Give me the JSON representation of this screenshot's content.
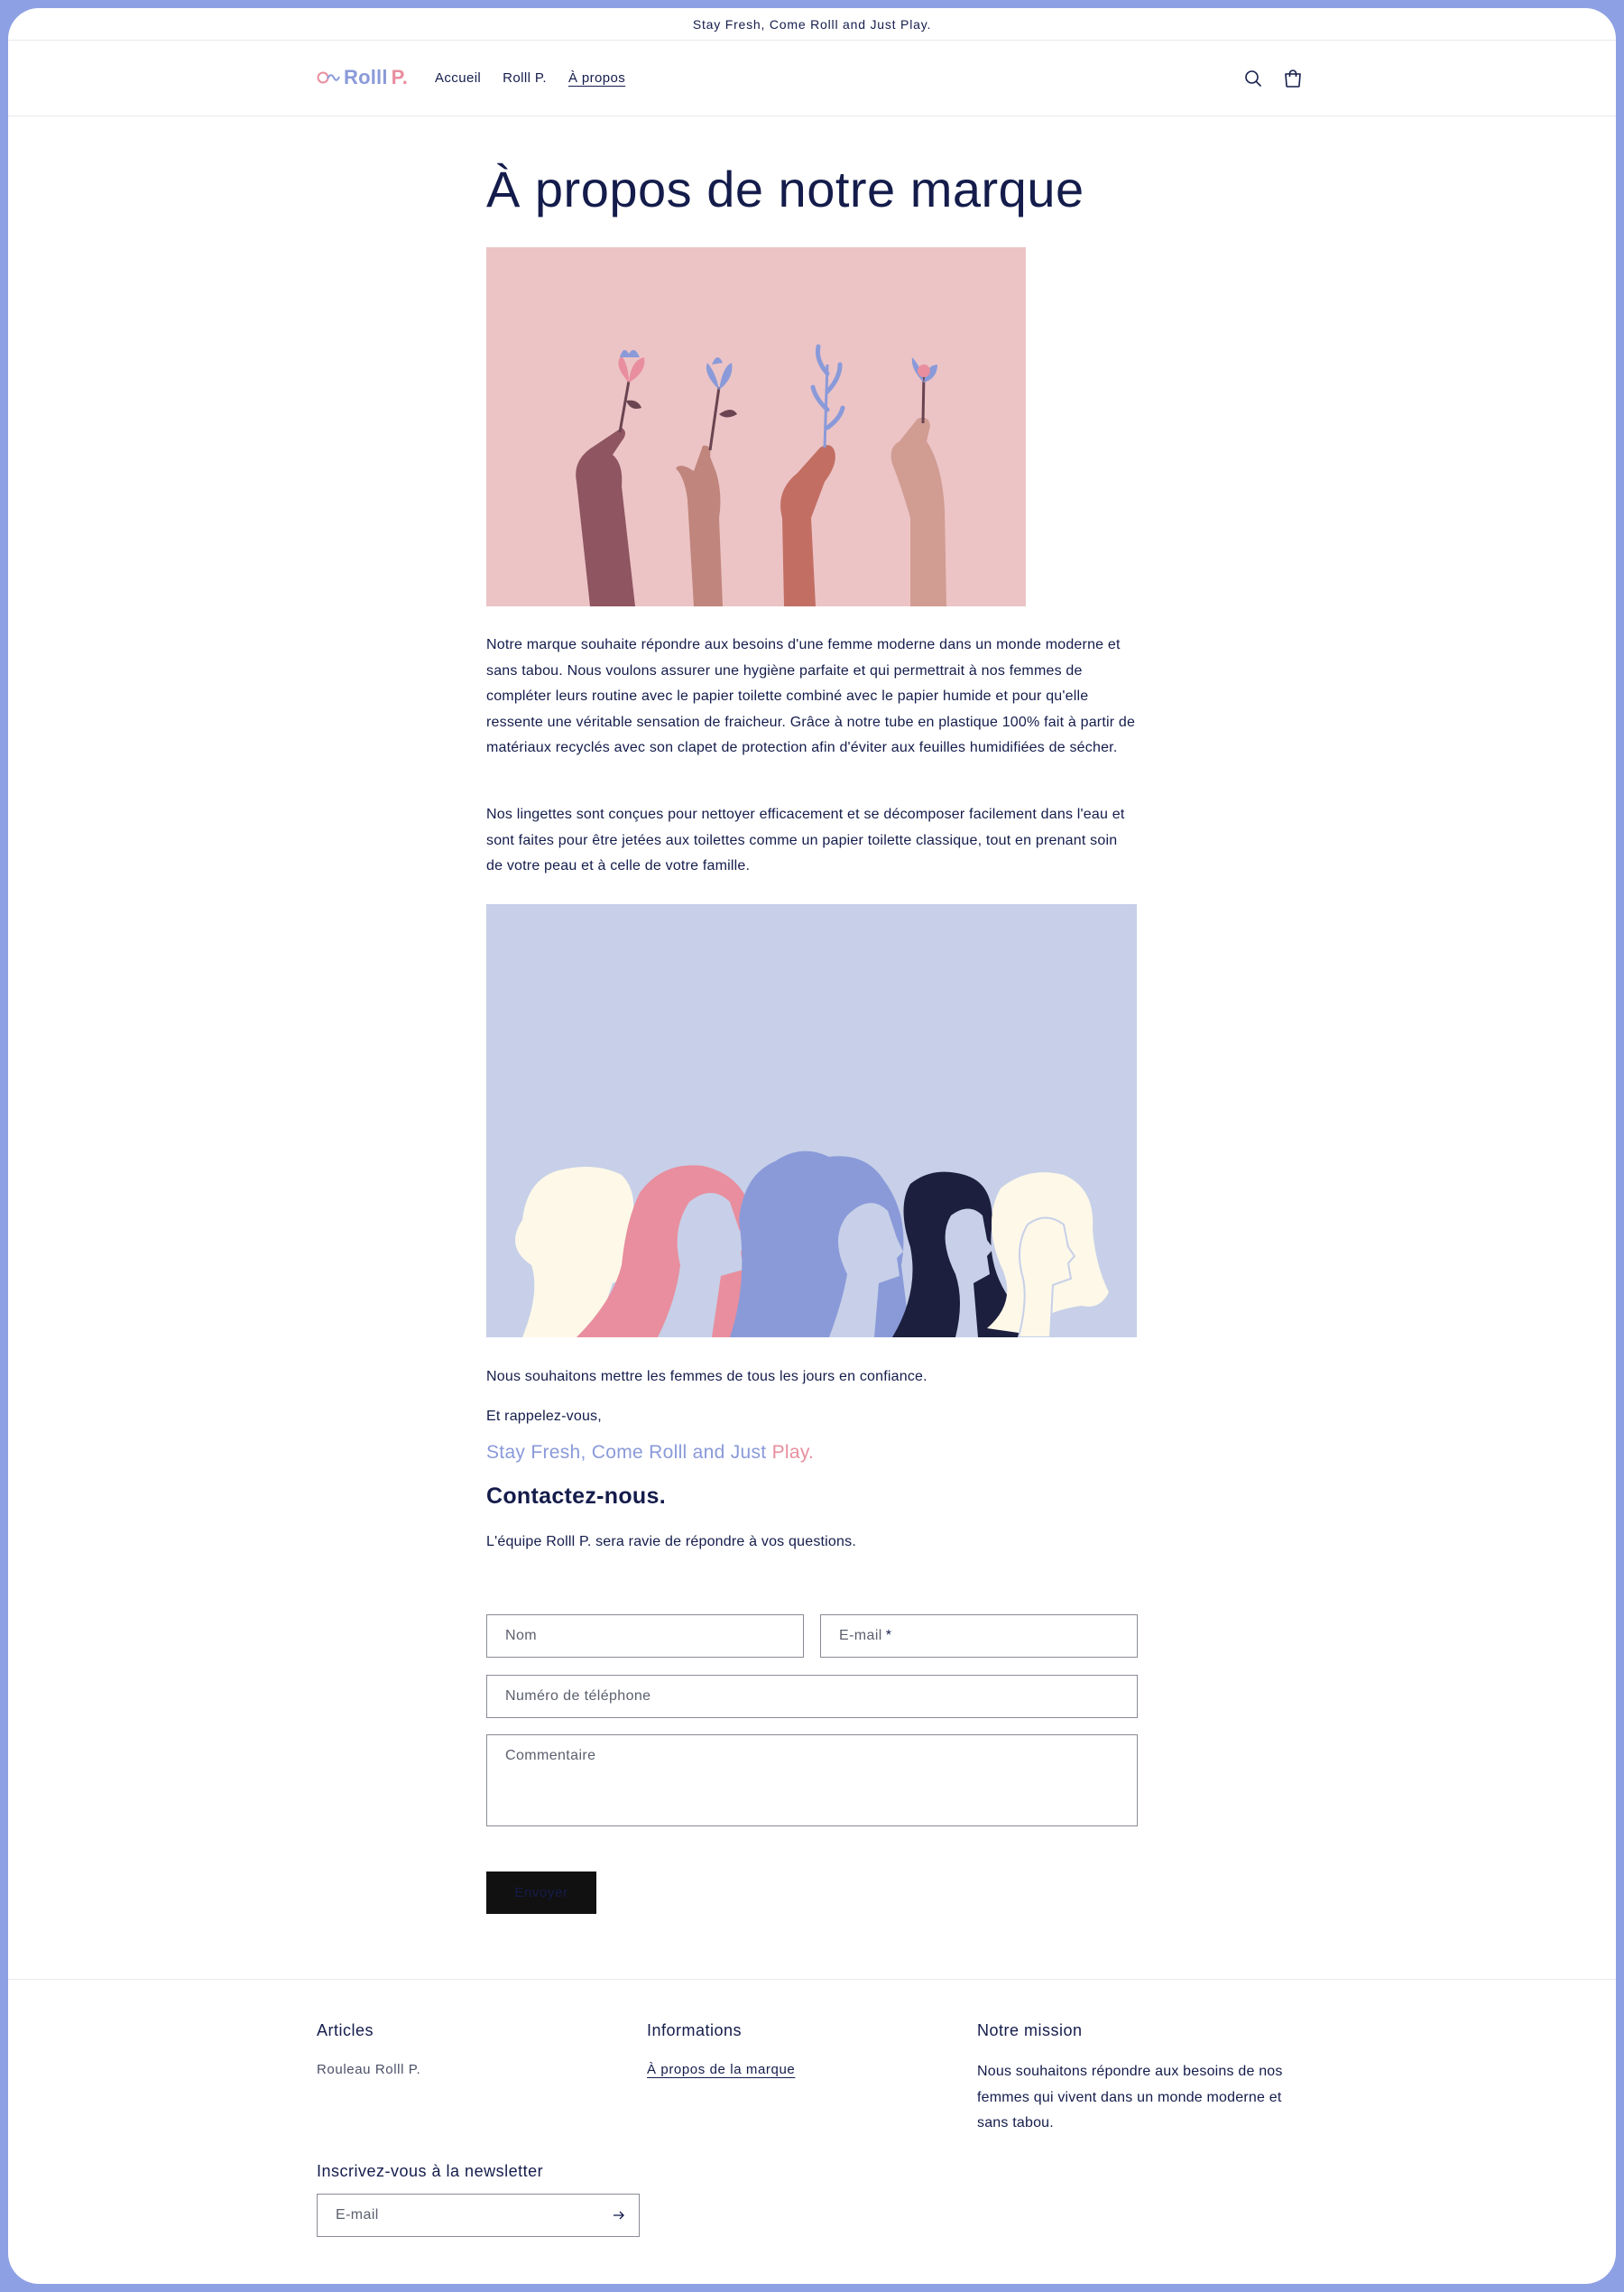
{
  "announcement": "Stay Fresh, Come Rolll and Just Play.",
  "header": {
    "logo_part1": "Rolll",
    "logo_part2": "P.",
    "nav": [
      "Accueil",
      "Rolll P.",
      "À propos"
    ],
    "icons": [
      "search-icon",
      "cart-icon"
    ]
  },
  "main": {
    "title": "À propos de notre marque",
    "paragraph1": "Notre marque souhaite répondre aux besoins d'une femme moderne dans un monde moderne et sans tabou. Nous voulons assurer une hygiène parfaite et qui permettrait à nos femmes de compléter leurs routine avec le papier toilette combiné avec le papier humide et pour qu'elle ressente une véritable sensation de fraicheur. Grâce à notre tube en plastique 100% fait à partir de matériaux recyclés avec son clapet de protection afin d'éviter aux feuilles humidifiées de sécher.",
    "paragraph2": "Nos lingettes sont conçues pour nettoyer efficacement et se décomposer facilement dans l'eau et sont faites pour être jetées aux toilettes comme un papier toilette classique, tout en prenant soin de votre peau et à celle de votre famille.",
    "paragraph3": "Nous souhaitons mettre les femmes de tous les jours en confiance.",
    "paragraph4": "Et rappelez-vous,",
    "slogan_part1": "Stay Fresh, Come Rolll and Just ",
    "slogan_part2": "Play.",
    "contact_title": "Contactez-nous.",
    "contact_sub": "L'équipe Rolll P. sera ravie de répondre à vos questions."
  },
  "form": {
    "name_placeholder": "Nom",
    "email_placeholder": "E-mail",
    "email_required": "*",
    "phone_placeholder": "Numéro de téléphone",
    "comment_placeholder": "Commentaire",
    "submit_label": "Envoyer"
  },
  "footer": {
    "col1_title": "Articles",
    "col1_item": "Rouleau Rolll P.",
    "col2_title": "Informations",
    "col2_link": "À propos de la marque",
    "col3_title": "Notre mission",
    "col3_text": "Nous souhaitons répondre aux besoins de nos femmes qui vivent dans un monde moderne et sans tabou.",
    "newsletter_title": "Inscrivez-vous à la newsletter",
    "newsletter_placeholder": "E-mail"
  },
  "colors": {
    "brand_blue": "#8a9ad9",
    "brand_pink": "#e88e9e",
    "text_navy": "#141c4b",
    "frame": "#8ea0e4"
  }
}
